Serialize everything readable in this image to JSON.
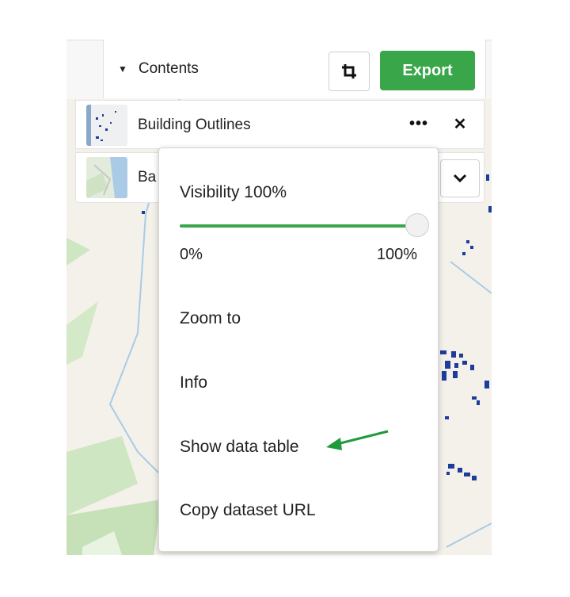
{
  "header": {
    "contents_label": "Contents",
    "export_label": "Export"
  },
  "layers": [
    {
      "name": "Building Outlines"
    },
    {
      "name": "Ba"
    }
  ],
  "menu": {
    "visibility_label": "Visibility 100%",
    "visibility_value": 100,
    "slider_min": "0%",
    "slider_max": "100%",
    "items": [
      {
        "label": "Zoom to"
      },
      {
        "label": "Info"
      },
      {
        "label": "Show data table"
      },
      {
        "label": "Copy dataset URL"
      }
    ]
  },
  "colors": {
    "accent_green": "#3aa64a",
    "annotation_arrow": "#1f9a3c",
    "building_blue": "#1e3c9a"
  }
}
